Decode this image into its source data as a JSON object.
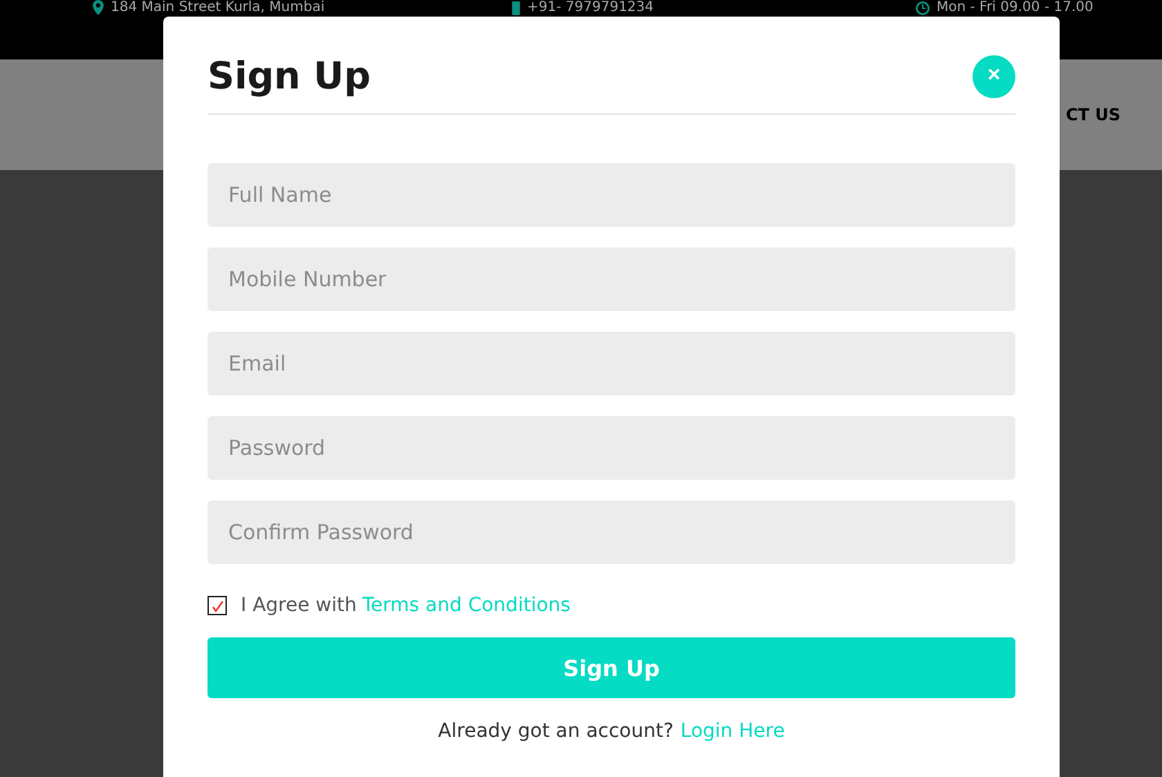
{
  "top_bar": {
    "items": [
      {
        "kind": "location",
        "text": "184 Main Street Kurla, Mumbai"
      },
      {
        "kind": "phone",
        "text": "+91- 7979791234"
      },
      {
        "kind": "clock",
        "text": "Mon - Fri 09.00 - 17.00"
      }
    ]
  },
  "nav": {
    "items": [
      "CT US"
    ]
  },
  "dialog": {
    "title": "Sign Up",
    "close_label": "×",
    "fields": [
      {
        "placeholder": "Full Name"
      },
      {
        "placeholder": "Mobile Number"
      },
      {
        "placeholder": "Email"
      },
      {
        "placeholder": "Password"
      },
      {
        "placeholder": "Confirm Password"
      }
    ],
    "agree": {
      "checked": true,
      "text": "I Agree with",
      "link": "Terms and Conditions"
    },
    "submit": "Sign Up",
    "footer": {
      "text": "Already got an account?",
      "link": "Login Here"
    }
  }
}
